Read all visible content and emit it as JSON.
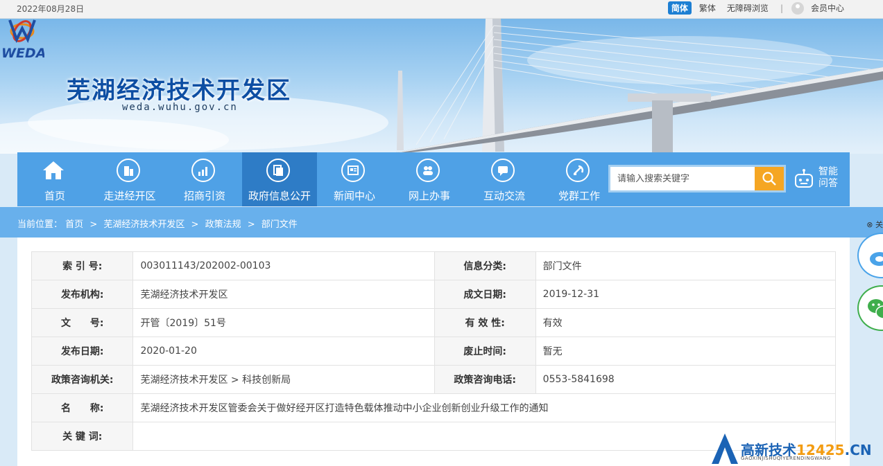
{
  "topbar": {
    "date": "2022年08月28日",
    "lang_simplified": "简体",
    "lang_traditional": "繁体",
    "accessibility": "无障碍浏览",
    "separator": "|",
    "member_center": "会员中心"
  },
  "header": {
    "logo_text": "WEDA",
    "title": "芜湖经济技术开发区",
    "domain": "weda.wuhu.gov.cn"
  },
  "nav": {
    "items": [
      {
        "label": "首页",
        "icon": "home-icon"
      },
      {
        "label": "走进经开区",
        "icon": "building-icon"
      },
      {
        "label": "招商引资",
        "icon": "chart-icon"
      },
      {
        "label": "政府信息公开",
        "icon": "document-icon",
        "active": true
      },
      {
        "label": "新闻中心",
        "icon": "newspaper-icon"
      },
      {
        "label": "网上办事",
        "icon": "people-icon"
      },
      {
        "label": "互动交流",
        "icon": "chat-icon"
      },
      {
        "label": "党群工作",
        "icon": "party-emblem-icon"
      }
    ],
    "search_placeholder": "请输入搜索关键字",
    "smart_qa_line1": "智能",
    "smart_qa_line2": "问答"
  },
  "breadcrumb": {
    "prefix": "当前位置：",
    "items": [
      "首页",
      "芜湖经济技术开发区",
      "政策法规",
      "部门文件"
    ],
    "separator": ">"
  },
  "side": {
    "close_label": "关"
  },
  "info_table": {
    "index_label": "索 引 号:",
    "index_value": "003011143/202002-00103",
    "category_label": "信息分类:",
    "category_value": "部门文件",
    "publisher_label": "发布机构:",
    "publisher_value": "芜湖经济技术开发区",
    "created_label": "成文日期:",
    "created_value": "2019-12-31",
    "docno_label": "文　　号:",
    "docno_value": "开管〔2019〕51号",
    "validity_label": "有 效 性:",
    "validity_value": "有效",
    "pubdate_label": "发布日期:",
    "pubdate_value": "2020-01-20",
    "abolish_label": "废止时间:",
    "abolish_value": "暂无",
    "consult_org_label": "政策咨询机关:",
    "consult_org_value": "芜湖经济技术开发区 > 科技创新局",
    "consult_phone_label": "政策咨询电话:",
    "consult_phone_value": "0553-5841698",
    "name_label": "名　　称:",
    "name_value": "芜湖经济技术开发区管委会关于做好经开区打造特色载体推动中小企业创新创业升级工作的通知",
    "keywords_label": "关 键 词:",
    "keywords_value": ""
  },
  "watermark": {
    "text_main": "高新技术",
    "text_num": "12425",
    "text_tail": ".CN",
    "sub": "GAOXINJISHUQIYERENDINGWANG"
  },
  "colors": {
    "nav_bg": "#4fa1e6",
    "nav_active": "#2e7cc6",
    "breadcrumb_bg": "#68b0ec",
    "search_button": "#f5a623",
    "title_blue": "#0d4ea3"
  }
}
